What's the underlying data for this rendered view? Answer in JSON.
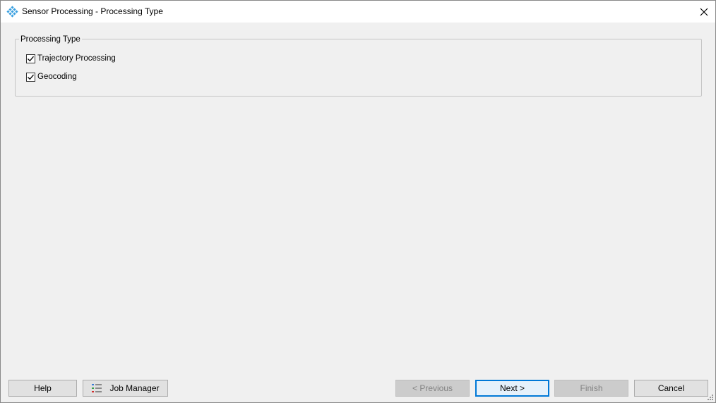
{
  "window": {
    "title": "Sensor Processing - Processing Type",
    "accent_color": "#0078d7"
  },
  "icons": {
    "app": "lattice-app-icon",
    "close": "close-icon",
    "job_manager": "list-icon",
    "check": "check-icon"
  },
  "processing_type": {
    "group_title": "Processing Type",
    "options": [
      {
        "label": "Trajectory Processing",
        "checked": true
      },
      {
        "label": "Geocoding",
        "checked": true
      }
    ]
  },
  "footer": {
    "help": "Help",
    "job_manager": "Job Manager",
    "previous": "< Previous",
    "next": "Next >",
    "finish": "Finish",
    "cancel": "Cancel"
  }
}
